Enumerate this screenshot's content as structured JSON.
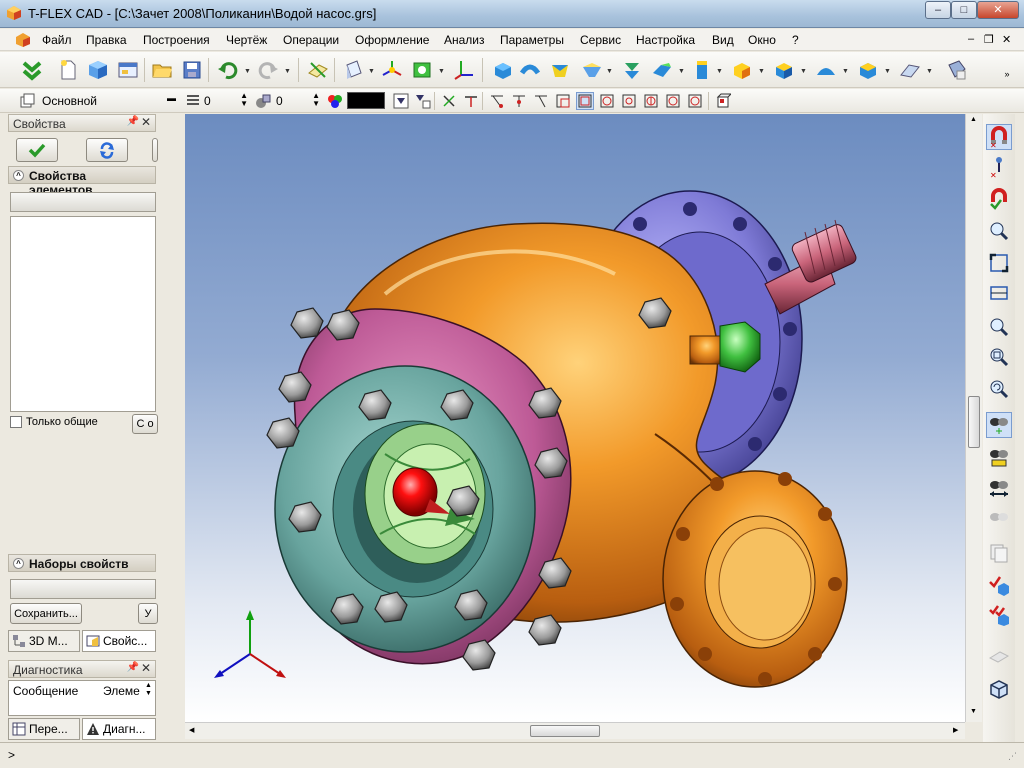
{
  "window": {
    "title": "T-FLEX CAD - [C:\\Зачет 2008\\Поликанин\\Водой насос.grs]",
    "controls": {
      "minimize": "–",
      "maximize": "□",
      "close": "✕"
    }
  },
  "menubar": {
    "items": [
      {
        "label": "Файл"
      },
      {
        "label": "Правка"
      },
      {
        "label": "Построения"
      },
      {
        "label": "Чертёж"
      },
      {
        "label": "Операции"
      },
      {
        "label": "Оформление"
      },
      {
        "label": "Анализ"
      },
      {
        "label": "Параметры"
      },
      {
        "label": "Сервис"
      },
      {
        "label": "Настройка"
      },
      {
        "label": "Вид"
      },
      {
        "label": "Окно"
      },
      {
        "label": "?"
      }
    ],
    "mdi_controls": {
      "minimize": "–",
      "restore": "❐",
      "close": "✕"
    }
  },
  "toolbar2": {
    "layer_value": "Основной",
    "level_value": "0",
    "priority_value": "0",
    "color_value": "#000000"
  },
  "left_panel": {
    "properties_title": "Свойства",
    "element_props_title": "Свойства элементов",
    "only_common_label": "Только общие",
    "only_common_button": "С о",
    "property_sets_title": "Наборы свойств",
    "save_button": "Сохранить...",
    "delete_button": "У",
    "tabs": [
      {
        "label": "3D М..."
      },
      {
        "label": "Свойс..."
      }
    ],
    "diagnostics_title": "Диагностика",
    "diag_columns": [
      "Сообщение",
      "Элеме"
    ],
    "bottom_tabs": [
      {
        "label": "Пере..."
      },
      {
        "label": "Диагн..."
      }
    ]
  },
  "statusbar": {
    "prompt": ">"
  },
  "colors": {
    "pump_body": "#e8841a",
    "flange_rear": "#8a86d8",
    "flange_front_ring": "#c767a0",
    "front_cover": "#6fa6a1",
    "impeller": "#b8e0a0",
    "nose": "#e01010",
    "shaft": "#c9647a",
    "plug": "#42c23e"
  }
}
